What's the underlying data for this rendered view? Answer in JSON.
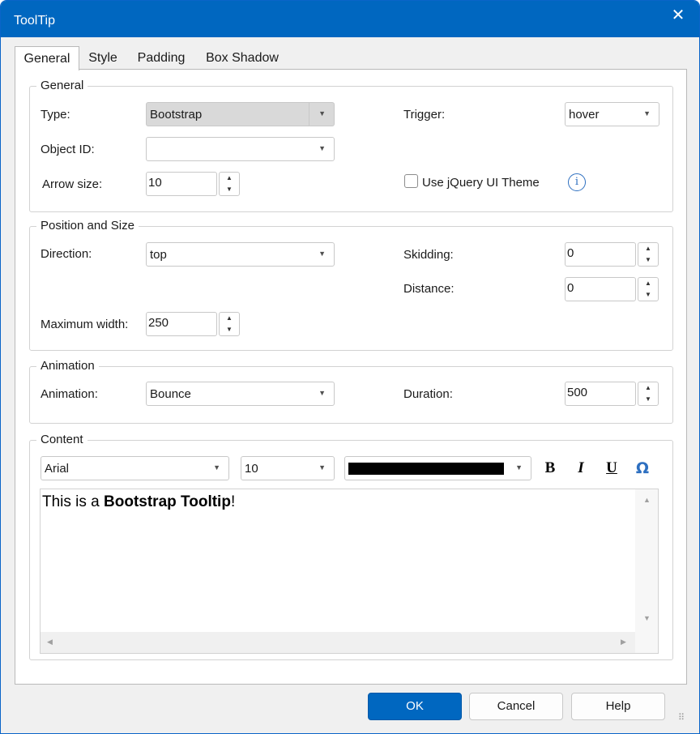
{
  "window": {
    "title": "ToolTip",
    "close_glyph": "✕"
  },
  "tabs": [
    {
      "label": "General",
      "active": true
    },
    {
      "label": "Style"
    },
    {
      "label": "Padding"
    },
    {
      "label": "Box Shadow"
    }
  ],
  "general_group": {
    "legend": "General",
    "type_label": "Type:",
    "type_value": "Bootstrap",
    "trigger_label": "Trigger:",
    "trigger_value": "hover",
    "object_id_label": "Object ID:",
    "object_id_value": "",
    "arrow_size_label": "Arrow size:",
    "arrow_size_value": "10",
    "jquery_theme_label": "Use jQuery UI Theme",
    "jquery_theme_checked": false,
    "info_glyph": "i"
  },
  "position_group": {
    "legend": "Position and Size",
    "direction_label": "Direction:",
    "direction_value": "top",
    "skidding_label": "Skidding:",
    "skidding_value": "0",
    "distance_label": "Distance:",
    "distance_value": "0",
    "max_width_label": "Maximum width:",
    "max_width_value": "250"
  },
  "animation_group": {
    "legend": "Animation",
    "animation_label": "Animation:",
    "animation_value": "Bounce",
    "duration_label": "Duration:",
    "duration_value": "500"
  },
  "content_group": {
    "legend": "Content",
    "font_value": "Arial",
    "size_value": "10",
    "color_value": "#000000",
    "bold_glyph": "B",
    "italic_glyph": "I",
    "underline_glyph": "U",
    "special_char_glyph": "Ω",
    "text_before": "This is a ",
    "text_bold": "Bootstrap Tooltip",
    "text_after": "!"
  },
  "buttons": {
    "ok": "OK",
    "cancel": "Cancel",
    "help": "Help"
  },
  "glyphs": {
    "dropdown": "▼",
    "spin_up": "▲",
    "spin_down": "▼",
    "scroll_up": "▲",
    "scroll_down": "▼",
    "scroll_left": "◀",
    "scroll_right": "▶",
    "grip": "⠿"
  },
  "icons": [
    "close-icon",
    "info-icon",
    "dropdown-arrow-icon",
    "spin-up-icon",
    "spin-down-icon",
    "bold-icon",
    "italic-icon",
    "underline-icon",
    "special-character-icon",
    "resize-grip-icon"
  ]
}
